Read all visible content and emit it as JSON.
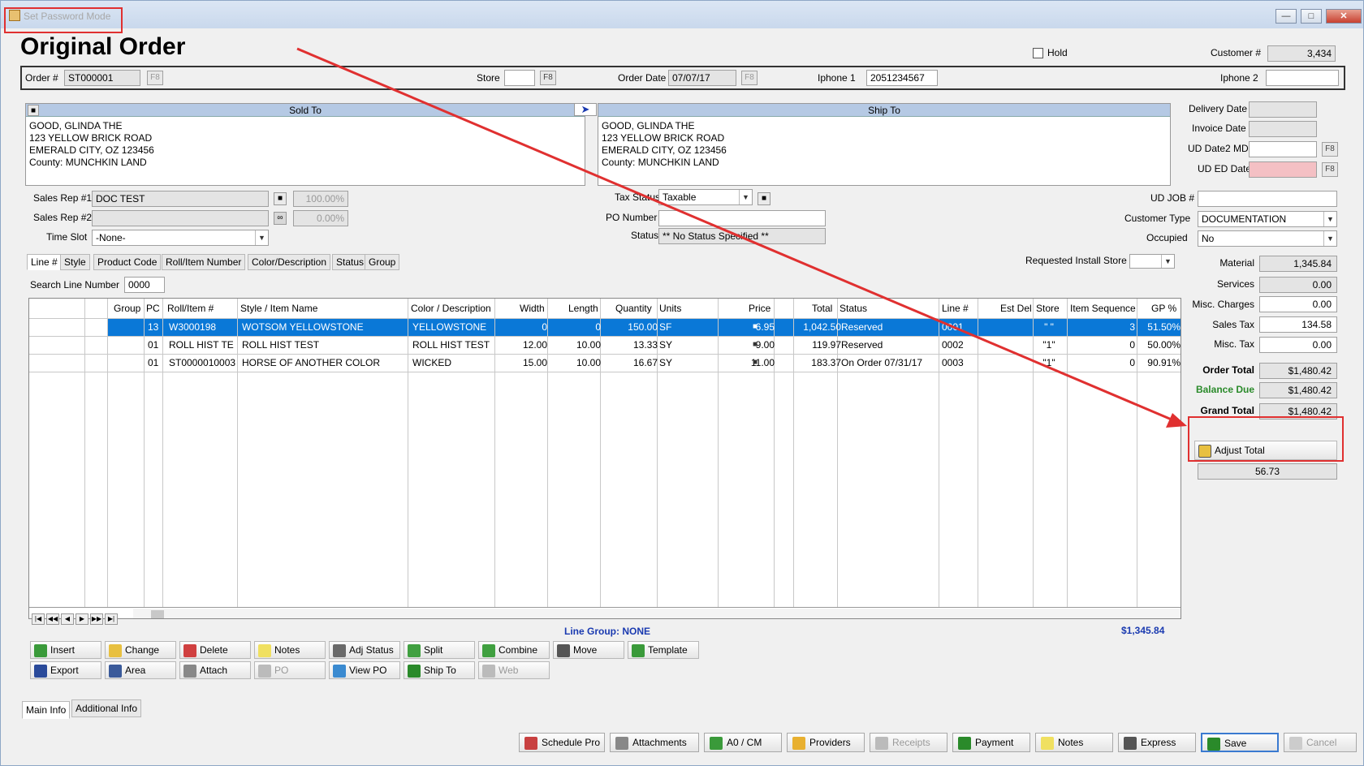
{
  "window": {
    "title": "Set Password Mode",
    "min": "—",
    "max": "□",
    "close": "✕"
  },
  "header": {
    "title": "Original Order",
    "hold_label": "Hold",
    "customer_label": "Customer #",
    "customer_value": "3,434"
  },
  "orderbar": {
    "order_label": "Order #",
    "order_value": "ST000001",
    "f8": "F8",
    "store_label": "Store",
    "store_value": "",
    "order_date_label": "Order Date",
    "order_date_value": "07/07/17",
    "iphone1_label": "Iphone 1",
    "iphone1_value": "2051234567",
    "iphone2_label": "Iphone 2",
    "iphone2_value": ""
  },
  "sold_to": {
    "header": "Sold To",
    "lines": [
      "GOOD, GLINDA THE",
      "123 YELLOW BRICK ROAD",
      "EMERALD CITY, OZ  123456",
      "County: MUNCHKIN LAND"
    ]
  },
  "ship_to": {
    "header": "Ship To",
    "lines": [
      "GOOD, GLINDA THE",
      "123 YELLOW BRICK ROAD",
      "EMERALD CITY, OZ  123456",
      "County: MUNCHKIN LAND"
    ]
  },
  "dates": {
    "delivery_label": "Delivery Date",
    "invoice_label": "Invoice Date",
    "ud_date2_label": "UD Date2 MD",
    "ud_ed_label": "UD ED Date"
  },
  "reps": {
    "rep1_label": "Sales Rep #1",
    "rep1_value": "DOC TEST",
    "rep1_pct": "100.00%",
    "rep2_label": "Sales Rep #2",
    "rep2_value": "",
    "rep2_pct": "0.00%",
    "timeslot_label": "Time Slot",
    "timeslot_value": "-None-"
  },
  "tax": {
    "tax_status_label": "Tax Status",
    "tax_status_value": "Taxable",
    "po_label": "PO Number",
    "po_value": "",
    "status_label": "Status",
    "status_value": "** No Status Specified **"
  },
  "udjob": {
    "udjob_label": "UD JOB #",
    "udjob_value": "",
    "custtype_label": "Customer Type",
    "custtype_value": "DOCUMENTATION",
    "occupied_label": "Occupied",
    "occupied_value": "No"
  },
  "tabs": [
    "Line #",
    "Style",
    "Product Code",
    "Roll/Item Number",
    "Color/Description",
    "Status",
    "Group"
  ],
  "requested_install_label": "Requested Install Store",
  "search": {
    "label": "Search Line Number",
    "value": "0000"
  },
  "grid": {
    "headers": [
      "Group",
      "PC",
      "Roll/Item #",
      "Style / Item Name",
      "Color / Description",
      "Width",
      "Length",
      "Quantity",
      "Units",
      "Price",
      "Total",
      "Status",
      "Line #",
      "Est Del",
      "Store",
      "Item Sequence",
      "GP %"
    ],
    "rows": [
      {
        "group": "",
        "pc": "13",
        "roll": "W3000198",
        "style": "WOTSOM YELLOWSTONE",
        "color": "YELLOWSTONE",
        "width": "0",
        "length": "0",
        "qty": "150.00",
        "units": "SF",
        "price": "6.95",
        "total": "1,042.50",
        "status": "Reserved",
        "line": "0001",
        "estdel": "",
        "store": "\" \"",
        "seq": "3",
        "gp": "51.50%"
      },
      {
        "group": "",
        "pc": "01",
        "roll": "ROLL HIST TE",
        "style": "ROLL HIST TEST",
        "color": "ROLL HIST TEST",
        "width": "12.00",
        "length": "10.00",
        "qty": "13.33",
        "units": "SY",
        "price": "9.00",
        "total": "119.97",
        "status": "Reserved",
        "line": "0002",
        "estdel": "",
        "store": "\"1\"",
        "seq": "0",
        "gp": "50.00%"
      },
      {
        "group": "",
        "pc": "01",
        "roll": "ST0000010003",
        "style": "HORSE OF ANOTHER COLOR",
        "color": "WICKED",
        "width": "15.00",
        "length": "10.00",
        "qty": "16.67",
        "units": "SY",
        "price": "11.00",
        "total": "183.37",
        "status": "On Order 07/31/17",
        "line": "0003",
        "estdel": "",
        "store": "\"1\"",
        "seq": "0",
        "gp": "90.91%"
      }
    ]
  },
  "line_group": "Line Group: NONE",
  "grid_total": "$1,345.84",
  "toolbar": {
    "row1": [
      "Insert",
      "Change",
      "Delete",
      "Notes",
      "Adj Status",
      "Split",
      "Combine",
      "Move",
      "Template"
    ],
    "row2": [
      "Export",
      "Area",
      "Attach",
      "PO",
      "View PO",
      "Ship To",
      "Web"
    ]
  },
  "bottom_tabs": [
    "Main Info",
    "Additional Info"
  ],
  "totals": {
    "material_label": "Material",
    "material": "1,345.84",
    "services_label": "Services",
    "services": "0.00",
    "misc_label": "Misc. Charges",
    "misc": "0.00",
    "salestax_label": "Sales Tax",
    "salestax": "134.58",
    "misctax_label": "Misc. Tax",
    "misctax": "0.00",
    "ordertotal_label": "Order Total",
    "ordertotal": "$1,480.42",
    "balancedue_label": "Balance Due",
    "balancedue": "$1,480.42",
    "grandtotal_label": "Grand Total",
    "grandtotal": "$1,480.42",
    "adjust_label": "Adjust Total",
    "adjust_value": "56.73"
  },
  "footer": [
    "Schedule Pro",
    "Attachments",
    "A0 / CM",
    "Providers",
    "Receipts",
    "Payment",
    "Notes",
    "Express",
    "Save",
    "Cancel"
  ],
  "colors": {
    "accent": "#0a78d7",
    "highlight": "#e03030",
    "balance": "#2a8a2a",
    "header": "#b5c9e4"
  }
}
